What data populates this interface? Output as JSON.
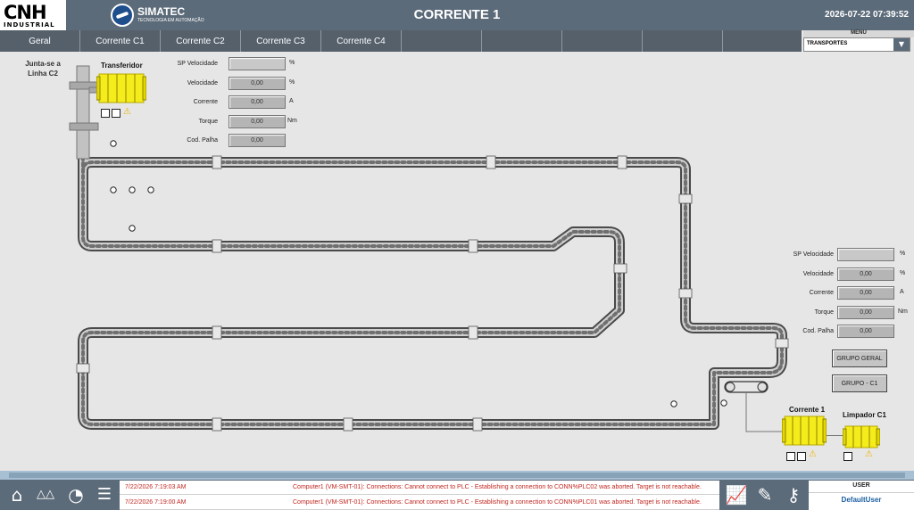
{
  "header": {
    "logo_text": "CNH",
    "logo_sub": "INDUSTRIAL",
    "simatec_name": "SIMATEC",
    "simatec_tag": "TECNOLOGIA EM AUTOMAÇÃO",
    "title": "CORRENTE 1",
    "datetime": "2026-07-22 07:39:52",
    "bg_color": "#5c6b7a"
  },
  "nav": {
    "tabs": [
      {
        "label": "Geral"
      },
      {
        "label": "Corrente C1"
      },
      {
        "label": "Corrente C2"
      },
      {
        "label": "Corrente C3"
      },
      {
        "label": "Corrente C4"
      },
      {
        "label": ""
      },
      {
        "label": ""
      },
      {
        "label": ""
      },
      {
        "label": ""
      },
      {
        "label": ""
      }
    ]
  },
  "menu": {
    "label": "MENU",
    "selected": "TRANSPORTES"
  },
  "labels": {
    "junta": "Junta-se a Linha  C2",
    "transferidor": "Transferidor",
    "corrente1": "Corrente 1",
    "limpador": "Limpador C1"
  },
  "panel_top": {
    "rows": [
      {
        "label": "SP Velocidade",
        "value": "",
        "unit": "%"
      },
      {
        "label": "Velocidade",
        "value": "0,00",
        "unit": "%"
      },
      {
        "label": "Corrente",
        "value": "0,00",
        "unit": "A"
      },
      {
        "label": "Torque",
        "value": "0,00",
        "unit": "Nm"
      },
      {
        "label": "Cod. Palha",
        "value": "0,00",
        "unit": ""
      }
    ]
  },
  "panel_right": {
    "rows": [
      {
        "label": "SP Velocidade",
        "value": "",
        "unit": "%"
      },
      {
        "label": "Velocidade",
        "value": "0,00",
        "unit": "%"
      },
      {
        "label": "Corrente",
        "value": "0,00",
        "unit": "A"
      },
      {
        "label": "Torque",
        "value": "0,00",
        "unit": "Nm"
      },
      {
        "label": "Cod. Palha",
        "value": "0,00",
        "unit": ""
      }
    ]
  },
  "buttons": {
    "grupo_geral": "GRUPO GERAL",
    "grupo_c1": "GRUPO - C1"
  },
  "alarms": [
    {
      "time": "7/22/2026 7:19:03 AM",
      "message": "Computer1 (VM-SMT-01): Connections: Cannot connect to PLC - Establishing a connection to CONN%PLC02 was aborted. Target is not reachable."
    },
    {
      "time": "7/22/2026 7:19:00 AM",
      "message": "Computer1 (VM-SMT-01): Connections: Cannot connect to PLC - Establishing a connection to CONN%PLC01 was aborted. Target is not reachable."
    }
  ],
  "user": {
    "label": "USER",
    "name": "DefaultUser"
  },
  "icons": [
    "home-icon",
    "group-icon",
    "gauge-icon",
    "list-icon",
    "trend-icon",
    "tools-icon",
    "key-icon",
    "warning-icon"
  ],
  "colors": {
    "device_yellow": "#f5ec1c",
    "alarm_red": "#c0261f",
    "warning_amber": "#f0b400"
  }
}
